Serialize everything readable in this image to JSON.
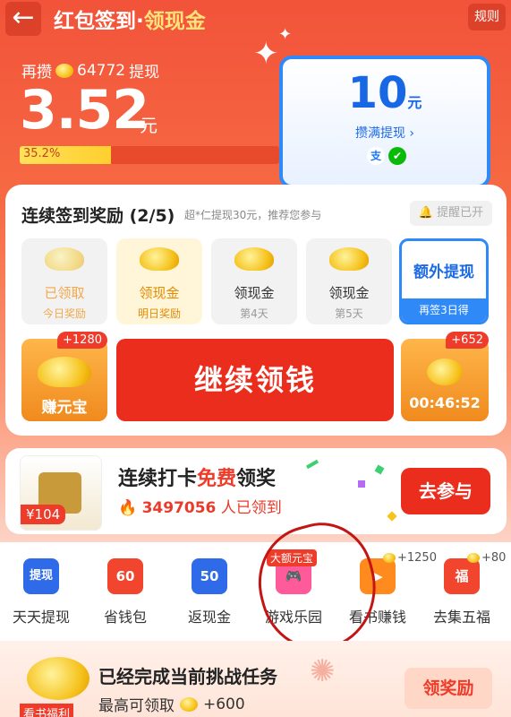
{
  "header": {
    "back_icon": "←",
    "title_main": "红包签到·",
    "title_hl": "领现金",
    "rules": "规则"
  },
  "balance": {
    "need_prefix": "再攒",
    "need_coins": "64772",
    "need_suffix": "提现",
    "amount": "3.52",
    "unit": "元",
    "progress_text": "35.2%",
    "progress_value": 0.352
  },
  "withdraw_card": {
    "amount": "10",
    "unit": "元",
    "sub": "攒满提现 ›"
  },
  "signin": {
    "title": "连续签到奖励 (2/5)",
    "subtitle": "超*仁提现30元，推荐您参与",
    "remind": "提醒已开",
    "days": [
      {
        "label": "已领取",
        "sub": "今日奖励"
      },
      {
        "label": "领现金",
        "sub": "明日奖励"
      },
      {
        "label": "领现金",
        "sub": "第4天"
      },
      {
        "label": "领现金",
        "sub": "第5天"
      }
    ],
    "extra": {
      "label": "额外提现",
      "sub": "再签3日得"
    },
    "earn": {
      "badge": "+1280",
      "label": "赚元宝"
    },
    "continue_btn": "继续领钱",
    "timer": {
      "badge": "+652",
      "time": "00:46:52"
    }
  },
  "checkin": {
    "price": "¥104",
    "title_a": "连续打卡",
    "title_free": "免费",
    "title_b": "领奖",
    "count": "3497056",
    "count_suffix": " 人已领到",
    "join_btn": "去参与"
  },
  "icons": [
    {
      "glyph": "提现",
      "label": "天天提现",
      "color": "#2f6be8"
    },
    {
      "glyph": "60",
      "label": "省钱包",
      "color": "#f2452e"
    },
    {
      "glyph": "50",
      "label": "返现金",
      "color": "#2f6be8"
    },
    {
      "glyph": "",
      "label": "游戏乐园",
      "color": "#ff5a9a",
      "tag": "大额元宝"
    },
    {
      "glyph": "▶",
      "label": "看书赚钱",
      "color": "#ff8a1e",
      "coins": "+1250"
    },
    {
      "glyph": "福",
      "label": "去集五福",
      "color": "#f2452e",
      "coins": "+80"
    }
  ],
  "bottom": {
    "tag": "看书福利",
    "title": "已经完成当前挑战任务",
    "sub": "最高可领取",
    "coins": "+600",
    "claim_btn": "领奖励"
  }
}
